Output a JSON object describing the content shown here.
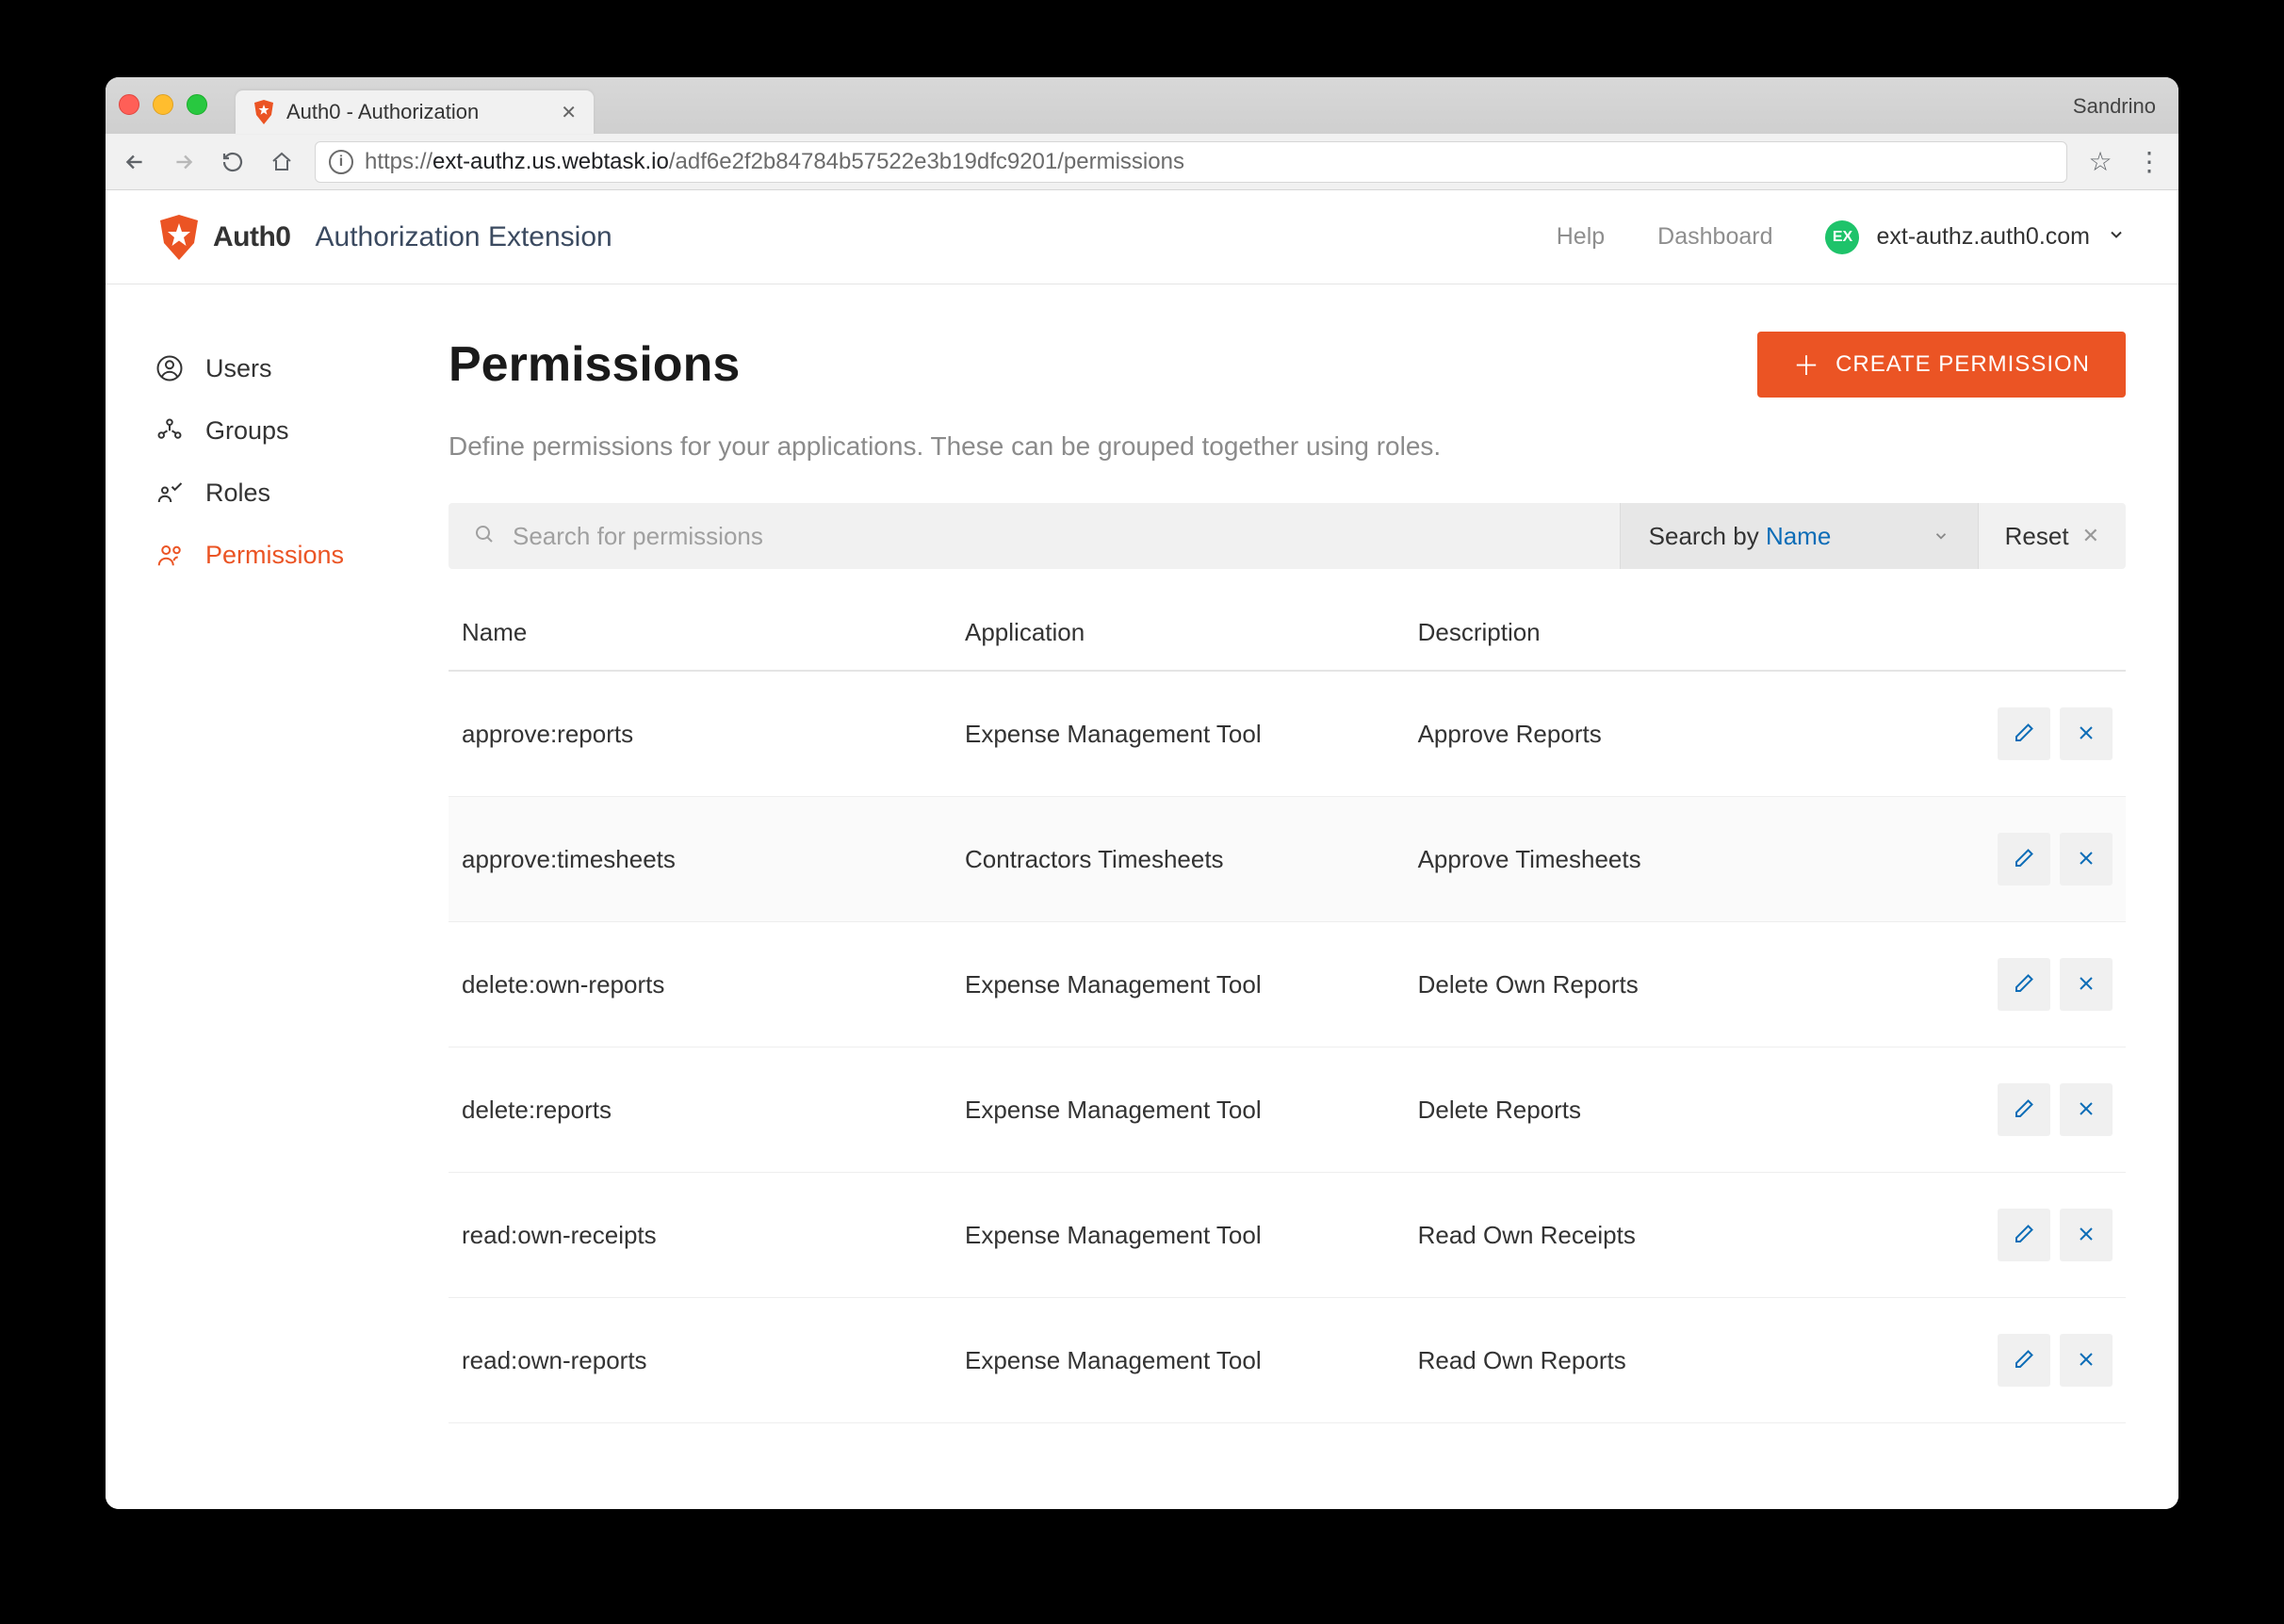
{
  "browser": {
    "tab_title": "Auth0 - Authorization",
    "profile": "Sandrino",
    "url_pre": "https://",
    "url_host": "ext-authz.us.webtask.io",
    "url_path": "/adf6e2f2b84784b57522e3b19dfc9201/permissions"
  },
  "header": {
    "logo_text": "Auth0",
    "extension_title": "Authorization Extension",
    "help": "Help",
    "dashboard": "Dashboard",
    "tenant_initials": "EX",
    "tenant_name": "ext-authz.auth0.com"
  },
  "sidebar": {
    "items": [
      {
        "label": "Users"
      },
      {
        "label": "Groups"
      },
      {
        "label": "Roles"
      },
      {
        "label": "Permissions"
      }
    ]
  },
  "page": {
    "title": "Permissions",
    "create_label": "CREATE PERMISSION",
    "description": "Define permissions for your applications. These can be grouped together using roles.",
    "search_placeholder": "Search for permissions",
    "search_by_prefix": "Search by ",
    "search_by_field": "Name",
    "reset": "Reset"
  },
  "table": {
    "columns": {
      "name": "Name",
      "application": "Application",
      "description": "Description"
    },
    "rows": [
      {
        "name": "approve:reports",
        "application": "Expense Management Tool",
        "description": "Approve Reports"
      },
      {
        "name": "approve:timesheets",
        "application": "Contractors Timesheets",
        "description": "Approve Timesheets"
      },
      {
        "name": "delete:own-reports",
        "application": "Expense Management Tool",
        "description": "Delete Own Reports"
      },
      {
        "name": "delete:reports",
        "application": "Expense Management Tool",
        "description": "Delete Reports"
      },
      {
        "name": "read:own-receipts",
        "application": "Expense Management Tool",
        "description": "Read Own Receipts"
      },
      {
        "name": "read:own-reports",
        "application": "Expense Management Tool",
        "description": "Read Own Reports"
      }
    ]
  }
}
